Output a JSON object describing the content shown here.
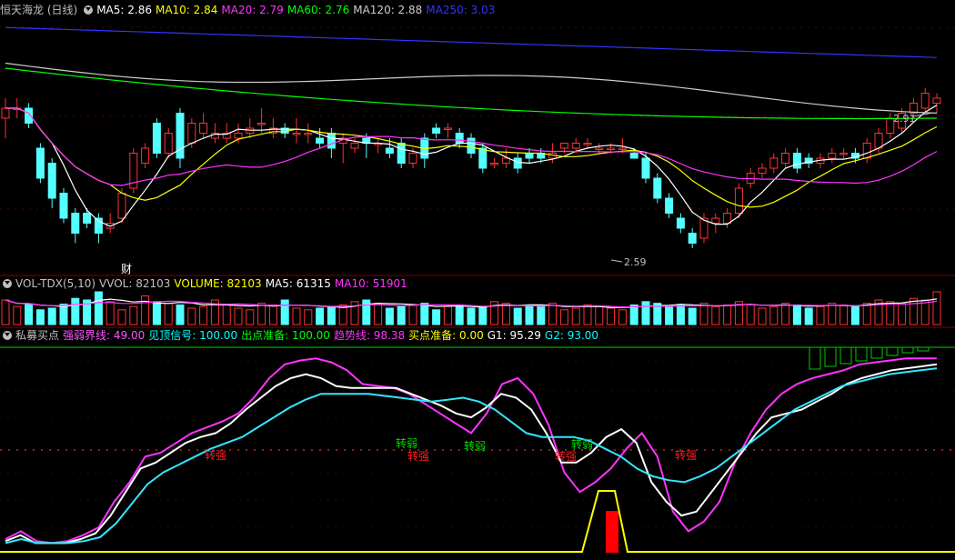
{
  "main": {
    "title": "恒天海龙 (日线)",
    "ma": [
      {
        "label": "MA5: 2.86",
        "color": "#ffffff"
      },
      {
        "label": "MA10: 2.84",
        "color": "#ffff00"
      },
      {
        "label": "MA20: 2.79",
        "color": "#ff33ff"
      },
      {
        "label": "MA60: 2.76",
        "color": "#00ff00"
      },
      {
        "label": "MA120: 2.88",
        "color": "#cccccc"
      },
      {
        "label": "MA250: 3.03",
        "color": "#3333ff"
      }
    ],
    "high_label": "2.91",
    "low_label": "2.59",
    "fin_marker": "财"
  },
  "volume": {
    "title": "VOL-TDX(5,10)",
    "items": [
      {
        "label": "VVOL: 82103",
        "color": "#c0c0c0"
      },
      {
        "label": "VOLUME: 82103",
        "color": "#ffff00"
      },
      {
        "label": "MA5: 61315",
        "color": "#ffffff"
      },
      {
        "label": "MA10: 51901",
        "color": "#ff33ff"
      }
    ]
  },
  "indicator": {
    "title": "私募买点",
    "items": [
      {
        "label": "强弱界线: 49.00",
        "color": "#ff55ff"
      },
      {
        "label": "见顶信号: 100.00",
        "color": "#00ffff"
      },
      {
        "label": "出点准备: 100.00",
        "color": "#00ff00"
      },
      {
        "label": "趋势线: 98.38",
        "color": "#ff33ff"
      },
      {
        "label": "买点准备: 0.00",
        "color": "#ffff00"
      },
      {
        "label": "G1: 95.29",
        "color": "#ffffff"
      },
      {
        "label": "G2: 93.00",
        "color": "#00ffff"
      }
    ],
    "signals": [
      {
        "text": "转强",
        "color": "#ff2020",
        "idx": 15
      },
      {
        "text": "转弱",
        "color": "#00dd00",
        "idx": 28
      },
      {
        "text": "转强",
        "color": "#ff2020",
        "idx": 30
      },
      {
        "text": "转弱",
        "color": "#00dd00",
        "idx": 34
      },
      {
        "text": "转弱",
        "color": "#00dd00",
        "idx": 42
      },
      {
        "text": "转强",
        "color": "#ff2020",
        "idx": 41
      },
      {
        "text": "转强",
        "color": "#ff2020",
        "idx": 50
      }
    ]
  },
  "chart_data": {
    "type": "candlestick",
    "ylim": [
      2.55,
      3.05
    ],
    "candles": [
      [
        2.85,
        2.87,
        2.81,
        2.89
      ],
      [
        2.87,
        2.87,
        2.85,
        2.89
      ],
      [
        2.87,
        2.84,
        2.83,
        2.88
      ],
      [
        2.79,
        2.73,
        2.72,
        2.8
      ],
      [
        2.76,
        2.69,
        2.67,
        2.77
      ],
      [
        2.7,
        2.65,
        2.64,
        2.71
      ],
      [
        2.66,
        2.62,
        2.6,
        2.67
      ],
      [
        2.66,
        2.64,
        2.63,
        2.67
      ],
      [
        2.65,
        2.62,
        2.6,
        2.66
      ],
      [
        2.63,
        2.64,
        2.62,
        2.66
      ],
      [
        2.65,
        2.7,
        2.64,
        2.71
      ],
      [
        2.71,
        2.78,
        2.7,
        2.79
      ],
      [
        2.76,
        2.79,
        2.75,
        2.8
      ],
      [
        2.84,
        2.78,
        2.77,
        2.85
      ],
      [
        2.78,
        2.82,
        2.77,
        2.83
      ],
      [
        2.86,
        2.77,
        2.75,
        2.87
      ],
      [
        2.8,
        2.84,
        2.79,
        2.85
      ],
      [
        2.82,
        2.84,
        2.81,
        2.86
      ],
      [
        2.81,
        2.82,
        2.8,
        2.84
      ],
      [
        2.81,
        2.82,
        2.8,
        2.84
      ],
      [
        2.81,
        2.82,
        2.8,
        2.84
      ],
      [
        2.82,
        2.83,
        2.81,
        2.85
      ],
      [
        2.84,
        2.84,
        2.82,
        2.87
      ],
      [
        2.82,
        2.83,
        2.81,
        2.85
      ],
      [
        2.83,
        2.82,
        2.81,
        2.84
      ],
      [
        2.82,
        2.82,
        2.8,
        2.85
      ],
      [
        2.82,
        2.82,
        2.8,
        2.84
      ],
      [
        2.81,
        2.8,
        2.79,
        2.83
      ],
      [
        2.82,
        2.79,
        2.77,
        2.83
      ],
      [
        2.8,
        2.81,
        2.76,
        2.82
      ],
      [
        2.79,
        2.8,
        2.78,
        2.81
      ],
      [
        2.81,
        2.8,
        2.77,
        2.82
      ],
      [
        2.8,
        2.8,
        2.78,
        2.81
      ],
      [
        2.79,
        2.78,
        2.77,
        2.81
      ],
      [
        2.8,
        2.76,
        2.75,
        2.81
      ],
      [
        2.76,
        2.78,
        2.75,
        2.79
      ],
      [
        2.81,
        2.77,
        2.75,
        2.82
      ],
      [
        2.83,
        2.82,
        2.81,
        2.84
      ],
      [
        2.83,
        2.83,
        2.81,
        2.84
      ],
      [
        2.82,
        2.8,
        2.79,
        2.83
      ],
      [
        2.81,
        2.78,
        2.77,
        2.82
      ],
      [
        2.79,
        2.75,
        2.74,
        2.8
      ],
      [
        2.76,
        2.76,
        2.75,
        2.77
      ],
      [
        2.76,
        2.77,
        2.75,
        2.79
      ],
      [
        2.77,
        2.75,
        2.74,
        2.78
      ],
      [
        2.78,
        2.77,
        2.76,
        2.79
      ],
      [
        2.78,
        2.77,
        2.76,
        2.79
      ],
      [
        2.77,
        2.78,
        2.76,
        2.8
      ],
      [
        2.79,
        2.8,
        2.78,
        2.8
      ],
      [
        2.79,
        2.8,
        2.78,
        2.81
      ],
      [
        2.8,
        2.8,
        2.79,
        2.81
      ],
      [
        2.79,
        2.79,
        2.78,
        2.8
      ],
      [
        2.79,
        2.79,
        2.78,
        2.8
      ],
      [
        2.79,
        2.79,
        2.78,
        2.81
      ],
      [
        2.78,
        2.77,
        2.77,
        2.79
      ],
      [
        2.77,
        2.73,
        2.72,
        2.78
      ],
      [
        2.73,
        2.69,
        2.68,
        2.74
      ],
      [
        2.69,
        2.66,
        2.65,
        2.7
      ],
      [
        2.65,
        2.63,
        2.62,
        2.66
      ],
      [
        2.62,
        2.6,
        2.59,
        2.63
      ],
      [
        2.61,
        2.65,
        2.6,
        2.66
      ],
      [
        2.64,
        2.65,
        2.62,
        2.66
      ],
      [
        2.64,
        2.66,
        2.63,
        2.67
      ],
      [
        2.66,
        2.71,
        2.65,
        2.72
      ],
      [
        2.72,
        2.74,
        2.71,
        2.75
      ],
      [
        2.74,
        2.75,
        2.73,
        2.76
      ],
      [
        2.75,
        2.77,
        2.74,
        2.78
      ],
      [
        2.76,
        2.78,
        2.75,
        2.79
      ],
      [
        2.78,
        2.75,
        2.74,
        2.79
      ],
      [
        2.77,
        2.76,
        2.75,
        2.78
      ],
      [
        2.76,
        2.77,
        2.75,
        2.78
      ],
      [
        2.77,
        2.78,
        2.76,
        2.79
      ],
      [
        2.78,
        2.78,
        2.77,
        2.79
      ],
      [
        2.78,
        2.77,
        2.76,
        2.79
      ],
      [
        2.77,
        2.8,
        2.76,
        2.81
      ],
      [
        2.79,
        2.82,
        2.78,
        2.83
      ],
      [
        2.82,
        2.85,
        2.81,
        2.86
      ],
      [
        2.83,
        2.86,
        2.82,
        2.87
      ],
      [
        2.86,
        2.88,
        2.85,
        2.89
      ],
      [
        2.87,
        2.9,
        2.86,
        2.91
      ],
      [
        2.88,
        2.89,
        2.86,
        2.9
      ]
    ],
    "volume": [
      30,
      22,
      25,
      18,
      20,
      25,
      32,
      30,
      40,
      28,
      18,
      22,
      35,
      28,
      26,
      24,
      20,
      22,
      30,
      24,
      20,
      18,
      26,
      24,
      30,
      20,
      18,
      20,
      22,
      24,
      28,
      30,
      26,
      20,
      22,
      24,
      26,
      18,
      22,
      24,
      20,
      22,
      28,
      26,
      20,
      24,
      22,
      26,
      18,
      20,
      24,
      22,
      20,
      18,
      24,
      28,
      26,
      22,
      24,
      20,
      26,
      22,
      24,
      28,
      24,
      20,
      22,
      26,
      24,
      20,
      22,
      26,
      24,
      22,
      26,
      30,
      28,
      26,
      32,
      30,
      40
    ],
    "indicator": {
      "ylim": [
        0,
        100
      ],
      "g1": [
        5,
        8,
        4,
        4,
        4,
        6,
        9,
        18,
        30,
        42,
        45,
        50,
        55,
        58,
        60,
        65,
        72,
        78,
        84,
        88,
        90,
        88,
        84,
        83,
        83,
        83,
        83,
        80,
        77,
        74,
        70,
        68,
        73,
        80,
        78,
        72,
        60,
        45,
        45,
        50,
        58,
        62,
        55,
        35,
        25,
        18,
        20,
        30,
        40,
        50,
        60,
        68,
        70,
        72,
        76,
        80,
        85,
        88,
        90,
        92,
        93,
        94,
        95
      ],
      "g2": [
        4,
        6,
        4,
        4,
        4,
        5,
        7,
        14,
        24,
        34,
        40,
        44,
        48,
        52,
        55,
        58,
        63,
        68,
        73,
        77,
        80,
        80,
        80,
        80,
        79,
        78,
        77,
        76,
        77,
        78,
        76,
        72,
        66,
        60,
        58,
        58,
        58,
        56,
        52,
        48,
        42,
        38,
        36,
        35,
        38,
        42,
        48,
        54,
        60,
        66,
        72,
        76,
        80,
        84,
        86,
        88,
        90,
        91,
        92,
        93
      ],
      "trend": [
        6,
        10,
        5,
        4,
        5,
        8,
        12,
        25,
        35,
        48,
        50,
        55,
        60,
        63,
        66,
        70,
        78,
        88,
        95,
        97,
        98,
        96,
        92,
        85,
        84,
        83,
        80,
        75,
        70,
        65,
        60,
        70,
        85,
        88,
        80,
        64,
        40,
        30,
        35,
        42,
        52,
        60,
        48,
        20,
        10,
        15,
        25,
        45,
        60,
        72,
        80,
        85,
        88,
        90,
        92,
        95,
        96,
        97,
        98,
        98,
        98
      ],
      "boxes": [
        20,
        25,
        25,
        28,
        30,
        32,
        34,
        36
      ]
    }
  }
}
